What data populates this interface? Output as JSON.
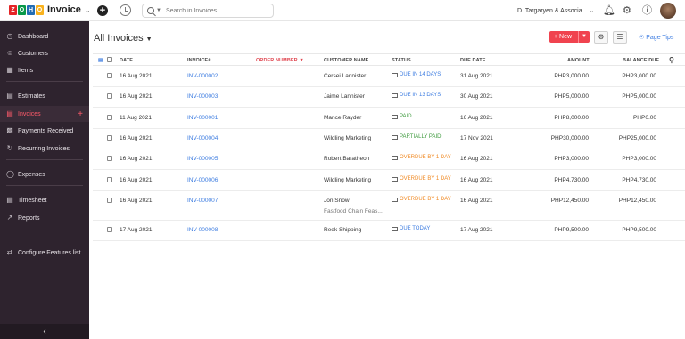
{
  "app": {
    "brand_letters": [
      "Z",
      "O",
      "H",
      "O"
    ],
    "brand_colors": [
      "#e42527",
      "#089949",
      "#226db4",
      "#f9b21d"
    ],
    "name": "Invoice",
    "org_name": "D. Targaryen & Associa...",
    "search_placeholder": "Search in Invoices"
  },
  "sidebar": {
    "items": [
      {
        "label": "Dashboard",
        "icon": "dashboard-icon"
      },
      {
        "label": "Customers",
        "icon": "customers-icon"
      },
      {
        "label": "Items",
        "icon": "items-icon"
      },
      {
        "label": "Estimates",
        "icon": "estimates-icon"
      },
      {
        "label": "Invoices",
        "icon": "invoices-icon"
      },
      {
        "label": "Payments Received",
        "icon": "payments-icon"
      },
      {
        "label": "Recurring Invoices",
        "icon": "recurring-icon"
      },
      {
        "label": "Expenses",
        "icon": "expenses-icon"
      },
      {
        "label": "Timesheet",
        "icon": "timesheet-icon"
      },
      {
        "label": "Reports",
        "icon": "reports-icon"
      },
      {
        "label": "Configure Features list",
        "icon": "configure-icon"
      }
    ],
    "active": "Invoices",
    "collapse_glyph": "‹"
  },
  "header": {
    "title": "All Invoices",
    "new_label": "+ New",
    "page_tips": "Page Tips"
  },
  "table": {
    "columns": [
      "DATE",
      "INVOICE#",
      "ORDER NUMBER",
      "CUSTOMER NAME",
      "STATUS",
      "DUE DATE",
      "AMOUNT",
      "BALANCE DUE"
    ],
    "sorted_column": "ORDER NUMBER",
    "rows": [
      {
        "date": "16 Aug 2021",
        "invoice": "INV-000002",
        "customer": "Cersei Lannister",
        "customer_sub": "",
        "status": "DUE IN 14 DAYS",
        "status_kind": "due",
        "due_date": "31 Aug 2021",
        "amount": "PHP3,000.00",
        "balance": "PHP3,000.00"
      },
      {
        "date": "16 Aug 2021",
        "invoice": "INV-000003",
        "customer": "Jaime Lannister",
        "customer_sub": "",
        "status": "DUE IN 13 DAYS",
        "status_kind": "due",
        "due_date": "30 Aug 2021",
        "amount": "PHP5,000.00",
        "balance": "PHP5,000.00"
      },
      {
        "date": "11 Aug 2021",
        "invoice": "INV-000001",
        "customer": "Mance Rayder",
        "customer_sub": "",
        "status": "PAID",
        "status_kind": "paid",
        "due_date": "16 Aug 2021",
        "amount": "PHP8,000.00",
        "balance": "PHP0.00"
      },
      {
        "date": "16 Aug 2021",
        "invoice": "INV-000004",
        "customer": "Wildling Marketing",
        "customer_sub": "",
        "status": "PARTIALLY PAID",
        "status_kind": "paid",
        "due_date": "17 Nov 2021",
        "amount": "PHP30,000.00",
        "balance": "PHP25,000.00"
      },
      {
        "date": "16 Aug 2021",
        "invoice": "INV-000005",
        "customer": "Robert Baratheon",
        "customer_sub": "",
        "status": "OVERDUE BY 1 DAY",
        "status_kind": "overdue",
        "due_date": "16 Aug 2021",
        "amount": "PHP3,000.00",
        "balance": "PHP3,000.00"
      },
      {
        "date": "16 Aug 2021",
        "invoice": "INV-000006",
        "customer": "Wildling Marketing",
        "customer_sub": "",
        "status": "OVERDUE BY 1 DAY",
        "status_kind": "overdue",
        "due_date": "16 Aug 2021",
        "amount": "PHP4,730.00",
        "balance": "PHP4,730.00"
      },
      {
        "date": "16 Aug 2021",
        "invoice": "INV-000007",
        "customer": "Jon Snow",
        "customer_sub": "Fastfood Chain Feas...",
        "status": "OVERDUE BY 1 DAY",
        "status_kind": "overdue",
        "due_date": "16 Aug 2021",
        "amount": "PHP12,450.00",
        "balance": "PHP12,450.00"
      },
      {
        "date": "17 Aug 2021",
        "invoice": "INV-000008",
        "customer": "Reek Shipping",
        "customer_sub": "",
        "status": "DUE TODAY",
        "status_kind": "due",
        "due_date": "17 Aug 2021",
        "amount": "PHP9,500.00",
        "balance": "PHP9,500.00"
      }
    ]
  },
  "colors": {
    "accent": "#f0434f",
    "link": "#3b7be0",
    "status_due": "#3b7be0",
    "status_paid": "#3d9a3d",
    "status_overdue": "#f08a24",
    "sidebar_bg": "#2e232e"
  }
}
